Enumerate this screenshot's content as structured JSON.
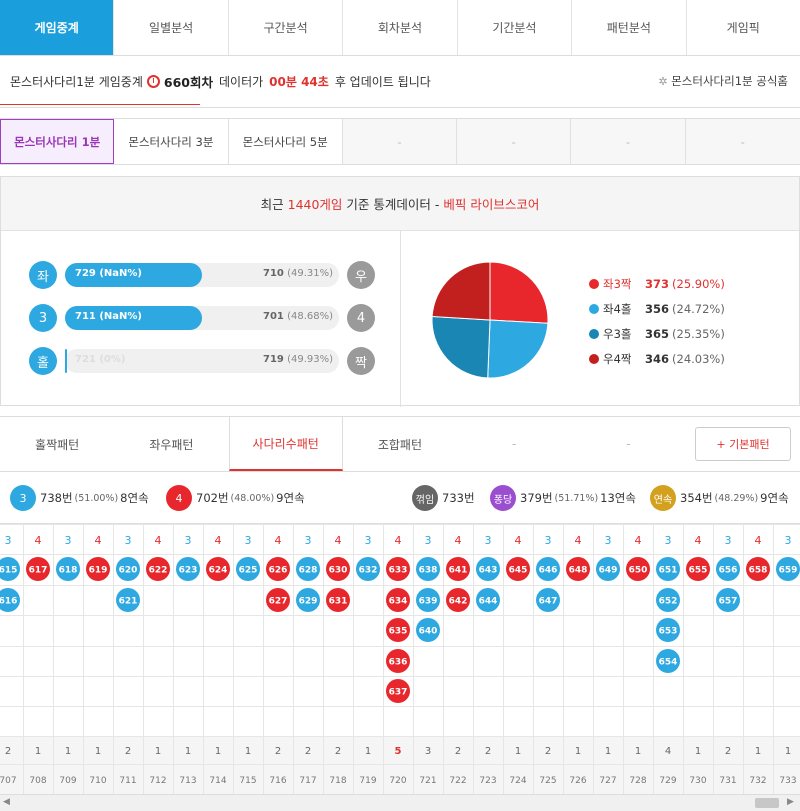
{
  "nav": [
    "게임중계",
    "일별분석",
    "구간분석",
    "회차분석",
    "기간분석",
    "패턴분석",
    "게임픽"
  ],
  "info": {
    "text1": "몬스터사다리1분 게임중계",
    "round": "660회차",
    "text2": "데이터가",
    "countdown": "00분 44초",
    "text3": "후 업데이트 됩니다",
    "home": "몬스터사다리1분 공식홈"
  },
  "subtabs": [
    "몬스터사다리 1분",
    "몬스터사다리 3분",
    "몬스터사다리 5분",
    "-",
    "-",
    "-",
    "-"
  ],
  "stats": {
    "title_a": "최근",
    "title_count": "1440게임",
    "title_b": "기준 통계데이터 -",
    "title_brand": "베픽 라이브스코어",
    "rows": [
      {
        "left_icon": "좌",
        "left_text": "729 (NaN%)",
        "fill": 0.5,
        "right_text": "710",
        "right_pct": "(49.31%)",
        "right_icon": "우"
      },
      {
        "left_icon": "3",
        "left_text": "711 (NaN%)",
        "fill": 0.5,
        "right_text": "701",
        "right_pct": "(48.68%)",
        "right_icon": "4"
      },
      {
        "left_icon": "홀",
        "left_text": "721 (0%)",
        "fill": 0,
        "right_text": "719",
        "right_pct": "(49.93%)",
        "right_icon": "짝"
      }
    ],
    "pie": [
      {
        "label": "좌3짝",
        "value": 373,
        "pct": "(25.90%)",
        "color": "#e8272c",
        "highlight": true
      },
      {
        "label": "좌4홀",
        "value": 356,
        "pct": "(24.72%)",
        "color": "#2ea8e0",
        "highlight": false
      },
      {
        "label": "우3홀",
        "value": 365,
        "pct": "(25.35%)",
        "color": "#1a86b4",
        "highlight": false
      },
      {
        "label": "우4짝",
        "value": 346,
        "pct": "(24.03%)",
        "color": "#c2201f",
        "highlight": false
      }
    ]
  },
  "ptabs": [
    "홀짝패턴",
    "좌우패턴",
    "사다리수패턴",
    "조합패턴",
    "-",
    "-"
  ],
  "basic_btn": "+ 기본패턴",
  "summary": [
    {
      "icon": "3",
      "color": "#2ea8e0",
      "count": "738번",
      "pct": "(51.00%)",
      "streak": "8연속"
    },
    {
      "icon": "4",
      "color": "#e8272c",
      "count": "702번",
      "pct": "(48.00%)",
      "streak": "9연속"
    },
    {
      "icon": "꺾임",
      "color": "#666",
      "count": "733번"
    },
    {
      "icon": "퐁당",
      "color": "#9b4fd0",
      "count": "379번",
      "pct": "(51.71%)",
      "streak": "13연속"
    },
    {
      "icon": "연속",
      "color": "#d4a020",
      "count": "354번",
      "pct": "(48.29%)",
      "streak": "9연속"
    }
  ],
  "columns": [
    {
      "h": "3",
      "b": [
        "615",
        "616"
      ],
      "n": "2",
      "r": "707"
    },
    {
      "h": "4",
      "b": [
        "617"
      ],
      "n": "1",
      "r": "708"
    },
    {
      "h": "3",
      "b": [
        "618"
      ],
      "n": "1",
      "r": "709"
    },
    {
      "h": "4",
      "b": [
        "619"
      ],
      "n": "1",
      "r": "710"
    },
    {
      "h": "3",
      "b": [
        "620",
        "621"
      ],
      "n": "2",
      "r": "711"
    },
    {
      "h": "4",
      "b": [
        "622"
      ],
      "n": "1",
      "r": "712"
    },
    {
      "h": "3",
      "b": [
        "623"
      ],
      "n": "1",
      "r": "713"
    },
    {
      "h": "4",
      "b": [
        "624"
      ],
      "n": "1",
      "r": "714"
    },
    {
      "h": "3",
      "b": [
        "625"
      ],
      "n": "1",
      "r": "715"
    },
    {
      "h": "4",
      "b": [
        "626",
        "627"
      ],
      "n": "2",
      "r": "716"
    },
    {
      "h": "3",
      "b": [
        "628",
        "629"
      ],
      "n": "2",
      "r": "717"
    },
    {
      "h": "4",
      "b": [
        "630",
        "631"
      ],
      "n": "2",
      "r": "718"
    },
    {
      "h": "3",
      "b": [
        "632"
      ],
      "n": "1",
      "r": "719"
    },
    {
      "h": "4",
      "b": [
        "633",
        "634",
        "635",
        "636",
        "637"
      ],
      "n": "5",
      "r": "720"
    },
    {
      "h": "3",
      "b": [
        "638",
        "639",
        "640"
      ],
      "n": "3",
      "r": "721"
    },
    {
      "h": "4",
      "b": [
        "641",
        "642"
      ],
      "n": "2",
      "r": "722"
    },
    {
      "h": "3",
      "b": [
        "643",
        "644"
      ],
      "n": "2",
      "r": "723"
    },
    {
      "h": "4",
      "b": [
        "645"
      ],
      "n": "1",
      "r": "724"
    },
    {
      "h": "3",
      "b": [
        "646",
        "647"
      ],
      "n": "2",
      "r": "725"
    },
    {
      "h": "4",
      "b": [
        "648"
      ],
      "n": "1",
      "r": "726"
    },
    {
      "h": "3",
      "b": [
        "649"
      ],
      "n": "1",
      "r": "727"
    },
    {
      "h": "4",
      "b": [
        "650"
      ],
      "n": "1",
      "r": "728"
    },
    {
      "h": "3",
      "b": [
        "651",
        "652",
        "653",
        "654"
      ],
      "n": "4",
      "r": "729"
    },
    {
      "h": "4",
      "b": [
        "655"
      ],
      "n": "1",
      "r": "730"
    },
    {
      "h": "3",
      "b": [
        "656",
        "657"
      ],
      "n": "2",
      "r": "731"
    },
    {
      "h": "4",
      "b": [
        "658"
      ],
      "n": "1",
      "r": "732"
    },
    {
      "h": "3",
      "b": [
        "659"
      ],
      "n": "1",
      "r": "733"
    }
  ],
  "colors": {
    "blue": "#2ea8e0",
    "red": "#e8272c",
    "accent": "#1a9fdc"
  }
}
